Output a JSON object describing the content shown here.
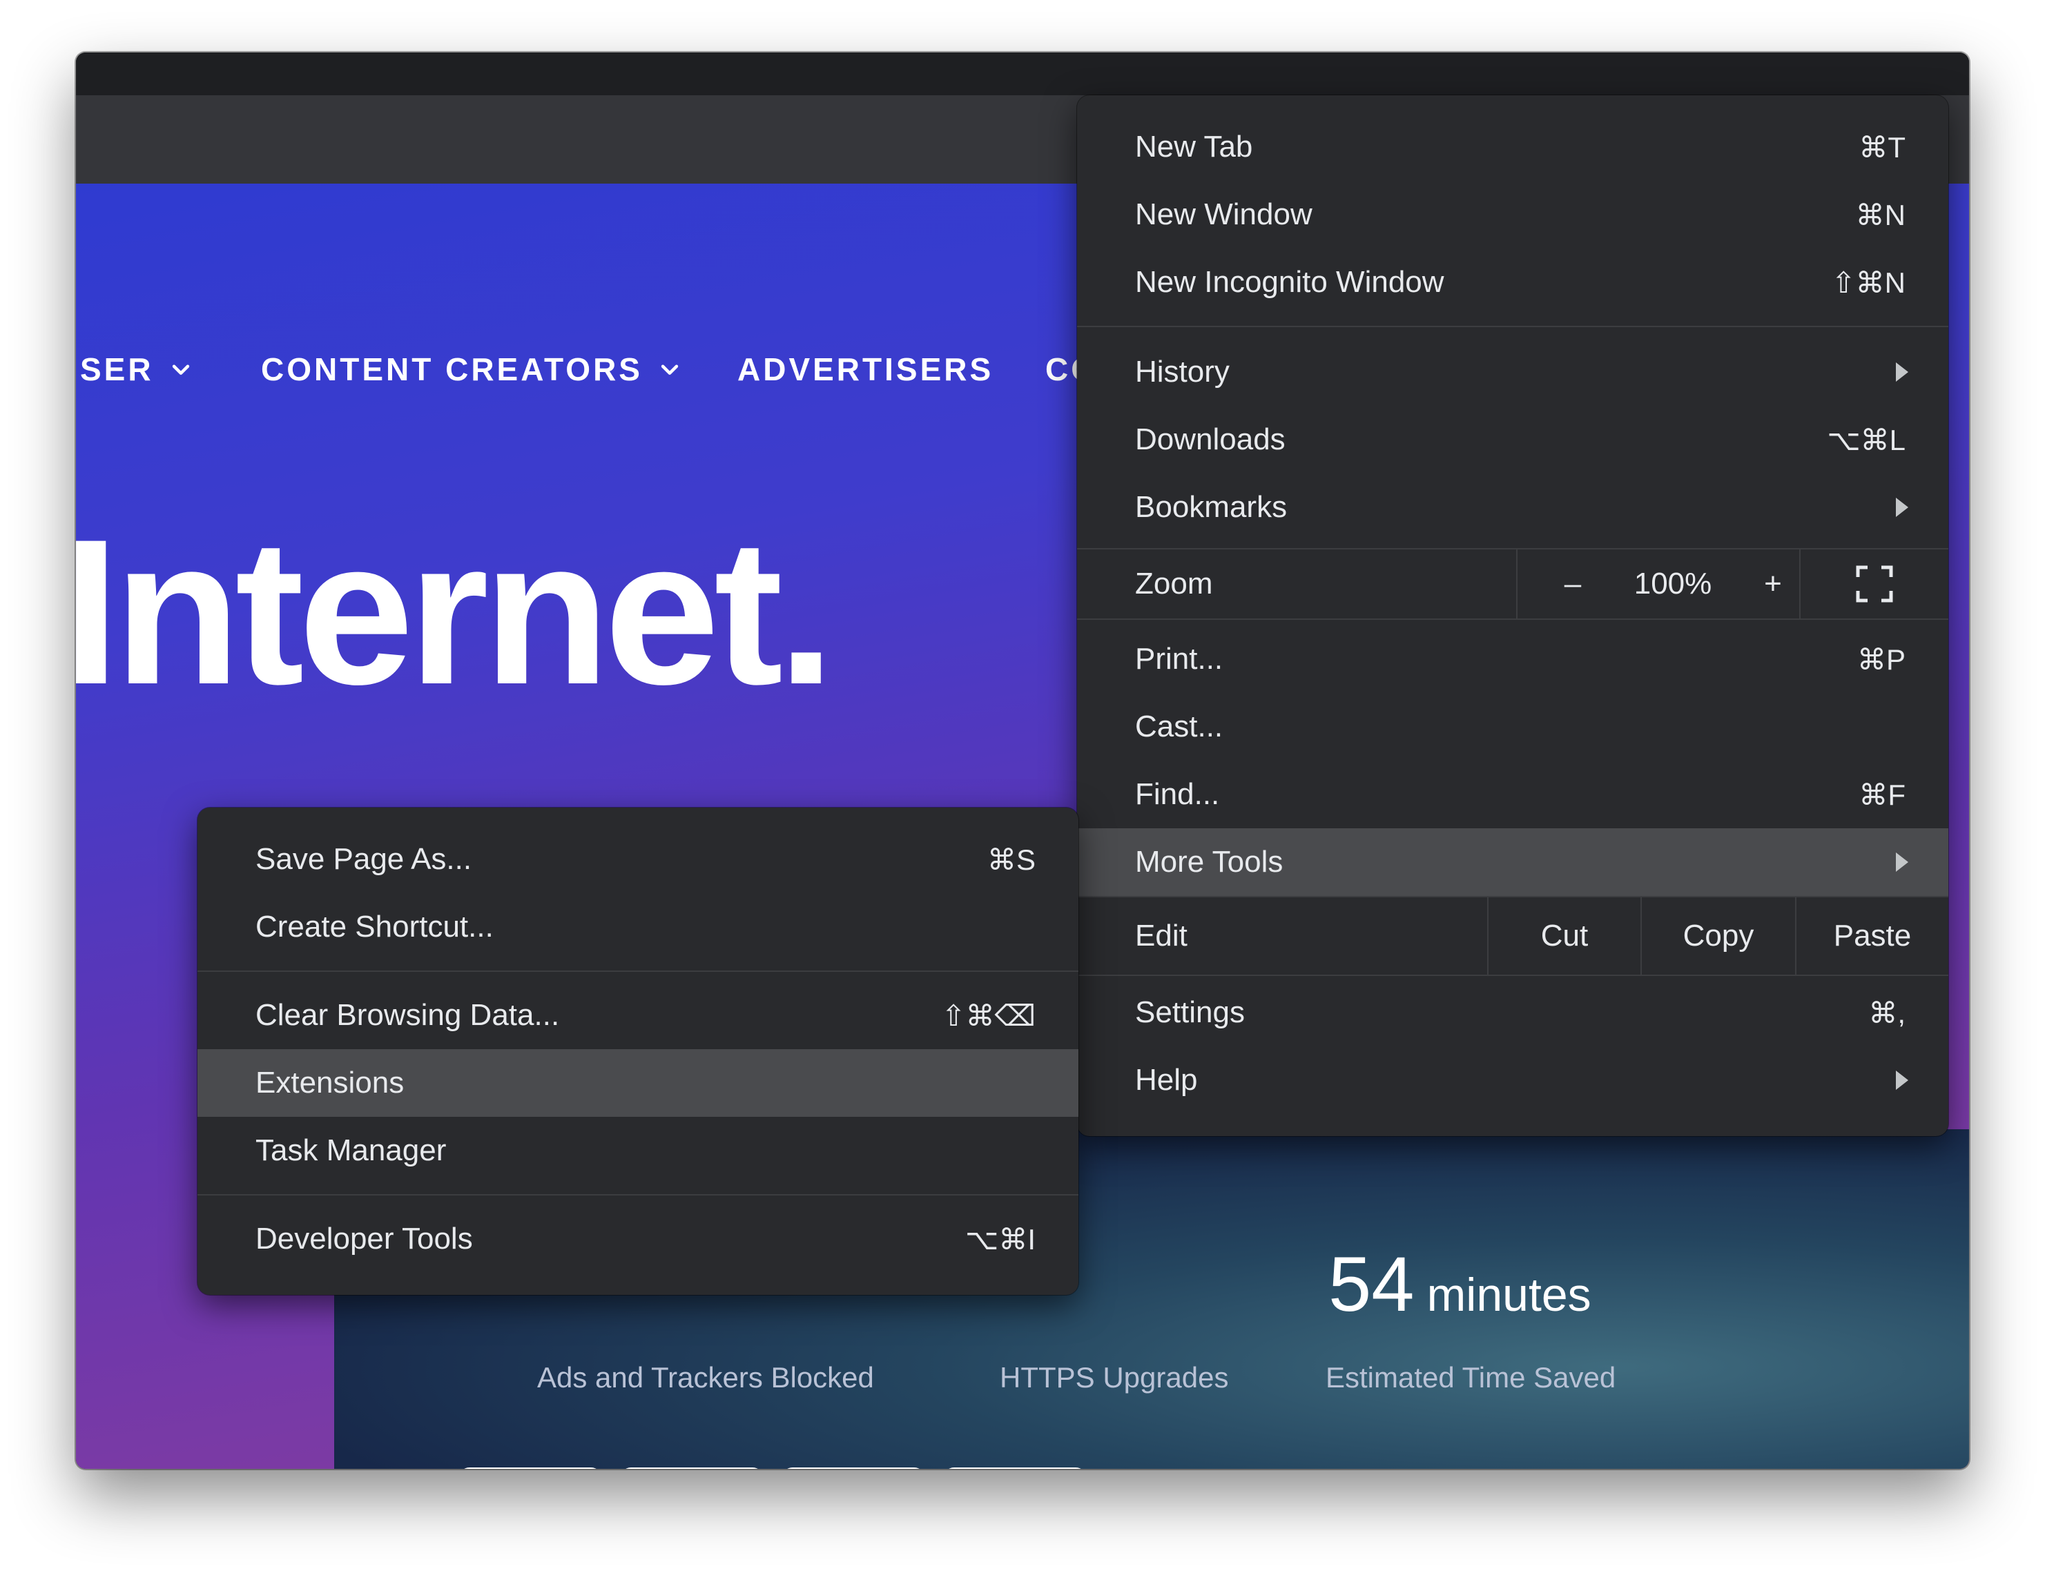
{
  "nav": {
    "items": [
      {
        "label": "SER"
      },
      {
        "label": "CONTENT CREATORS"
      },
      {
        "label": "ADVERTISERS"
      },
      {
        "label": "CO"
      }
    ]
  },
  "hero": {
    "text": "Internet."
  },
  "stats": {
    "time_saved_value": "54",
    "time_saved_unit": "minutes",
    "labels": [
      "Ads and Trackers Blocked",
      "HTTPS Upgrades",
      "Estimated Time Saved"
    ]
  },
  "main_menu": {
    "new_tab": {
      "label": "New Tab",
      "shortcut": "⌘T"
    },
    "new_window": {
      "label": "New Window",
      "shortcut": "⌘N"
    },
    "new_incognito": {
      "label": "New Incognito Window",
      "shortcut": "⇧⌘N"
    },
    "history": {
      "label": "History"
    },
    "downloads": {
      "label": "Downloads",
      "shortcut": "⌥⌘L"
    },
    "bookmarks": {
      "label": "Bookmarks"
    },
    "zoom": {
      "label": "Zoom",
      "minus": "–",
      "value": "100%",
      "plus": "+"
    },
    "print": {
      "label": "Print...",
      "shortcut": "⌘P"
    },
    "cast": {
      "label": "Cast..."
    },
    "find": {
      "label": "Find...",
      "shortcut": "⌘F"
    },
    "more_tools": {
      "label": "More Tools"
    },
    "edit": {
      "label": "Edit",
      "cut": "Cut",
      "copy": "Copy",
      "paste": "Paste"
    },
    "settings": {
      "label": "Settings",
      "shortcut": "⌘,"
    },
    "help": {
      "label": "Help"
    }
  },
  "sub_menu": {
    "save_page": {
      "label": "Save Page As...",
      "shortcut": "⌘S"
    },
    "create_shortcut": {
      "label": "Create Shortcut..."
    },
    "clear_data": {
      "label": "Clear Browsing Data...",
      "shortcut": "⇧⌘⌫"
    },
    "extensions": {
      "label": "Extensions"
    },
    "task_manager": {
      "label": "Task Manager"
    },
    "dev_tools": {
      "label": "Developer Tools",
      "shortcut": "⌥⌘I"
    }
  },
  "colors": {
    "menu_bg": "#292a2d",
    "menu_highlight": "#4a4b4e",
    "page_gradient_start": "#2f3bd0",
    "page_gradient_end": "#8a3d9c"
  }
}
